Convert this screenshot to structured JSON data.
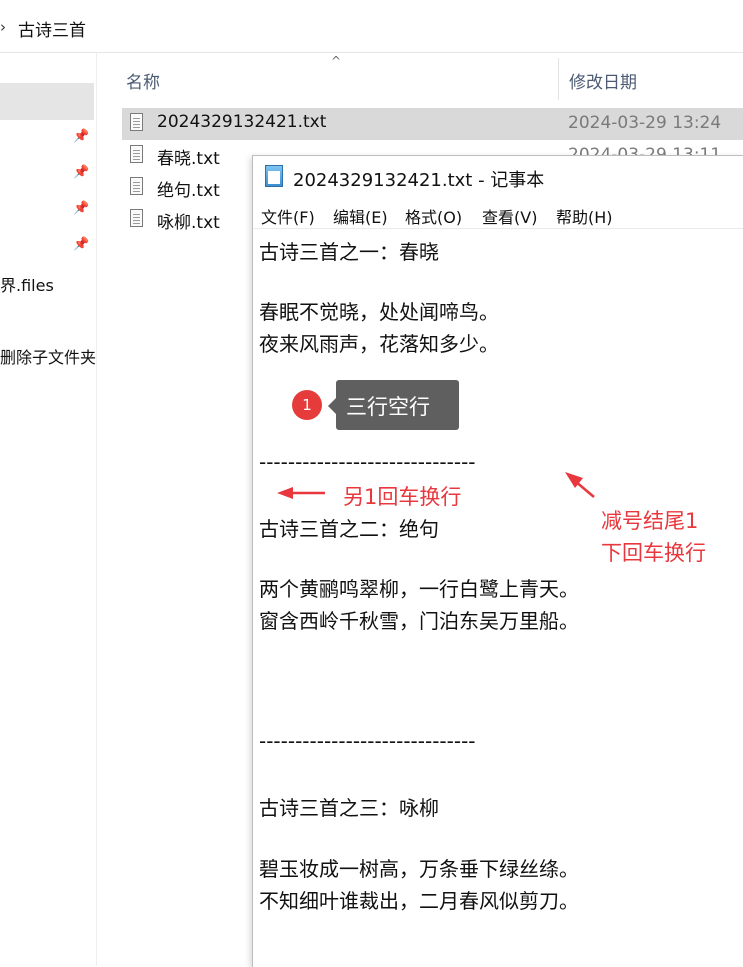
{
  "explorer": {
    "address": {
      "separator": "›",
      "path": "古诗三首"
    },
    "nav": {
      "pins": [
        "pin-icon",
        "pin-icon",
        "pin-icon",
        "pin-icon"
      ],
      "items": [
        "界.files",
        "删除子文件夹"
      ]
    },
    "columns": {
      "name": "名称",
      "modified": "修改日期",
      "sort_indicator": "^"
    },
    "files": [
      {
        "name": "2024329132421.txt",
        "date": "2024-03-29 13:24",
        "selected": true,
        "icon": "text-file-icon"
      },
      {
        "name": "春晓.txt",
        "date": "2024-03-29 13:11",
        "selected": false,
        "icon": "text-file-icon"
      },
      {
        "name": "绝句.txt",
        "date": "",
        "selected": false,
        "icon": "text-file-icon"
      },
      {
        "name": "咏柳.txt",
        "date": "",
        "selected": false,
        "icon": "text-file-icon"
      }
    ]
  },
  "notepad": {
    "title": "2024329132421.txt - 记事本",
    "icon": "notepad-icon",
    "menu": [
      "文件(F)",
      "编辑(E)",
      "格式(O)",
      "查看(V)",
      "帮助(H)"
    ],
    "lines": [
      "古诗三首之一：春晓",
      "春眠不觉晓，处处闻啼鸟。",
      "夜来风雨声，花落知多少。",
      "------------------------------",
      "古诗三首之二：绝句",
      "两个黄鹂鸣翠柳，一行白鹭上青天。",
      "窗含西岭千秋雪，门泊东吴万里船。",
      "------------------------------",
      "古诗三首之三：咏柳",
      "碧玉妆成一树高，万条垂下绿丝绦。",
      "不知细叶谁裁出，二月春风似剪刀。"
    ]
  },
  "annotations": {
    "badge_number": "1",
    "callout": "三行空行",
    "enter_note": "另1回车换行",
    "dash_note_line1": "减号结尾1",
    "dash_note_line2": "下回车换行",
    "color": "#e8383d"
  }
}
